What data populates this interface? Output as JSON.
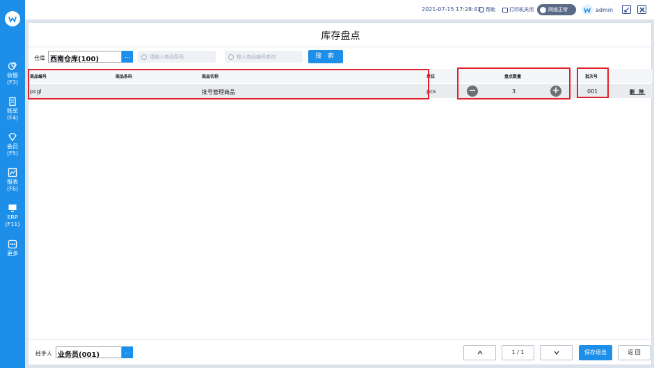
{
  "sidebar": {
    "logo_icon": "brand-logo-icon",
    "items": [
      {
        "label": "收银",
        "key": "(F3)",
        "icon": "cashier-icon"
      },
      {
        "label": "账单",
        "key": "(F4)",
        "icon": "bill-icon"
      },
      {
        "label": "会员",
        "key": "(F5)",
        "icon": "member-icon"
      },
      {
        "label": "报表",
        "key": "(F6)",
        "icon": "report-icon"
      },
      {
        "label": "ERP",
        "key": "(F11)",
        "icon": "erp-icon"
      },
      {
        "label": "更多",
        "key": "",
        "icon": "more-icon"
      }
    ]
  },
  "topbar": {
    "datetime": "2021-07-15 17:28:43",
    "help_label": "帮助",
    "printer_label": "打印机关闭",
    "network_label": "网络正常",
    "username": "admin"
  },
  "page": {
    "title": "库存盘点"
  },
  "filters": {
    "warehouse_label": "仓库",
    "warehouse_value": "西南仓库(100)",
    "more_button": "...",
    "barcode_placeholder": "请输入商品条码",
    "name_placeholder": "输入商品编码查询",
    "search_button": "搜 索"
  },
  "table": {
    "headers": {
      "code": "商品编号",
      "barcode": "商品条码",
      "name": "商品名称",
      "unit": "单位",
      "qty": "盘点数量",
      "batch": "批次号"
    },
    "rows": [
      {
        "code": "pcgl",
        "barcode": "",
        "name": "批号管理商品",
        "unit": "pcs",
        "qty": "3",
        "batch": "001",
        "delete": "删 除",
        "minus": "−",
        "plus": "+"
      }
    ]
  },
  "footer": {
    "operator_label": "经手人",
    "operator_value": "业务员(001)",
    "more_button": "...",
    "page_indicator": "1 / 1",
    "save_exit": "保存退出",
    "back": "返 回"
  },
  "colors": {
    "accent": "#1e8fe8",
    "highlight": "#e0202a"
  }
}
